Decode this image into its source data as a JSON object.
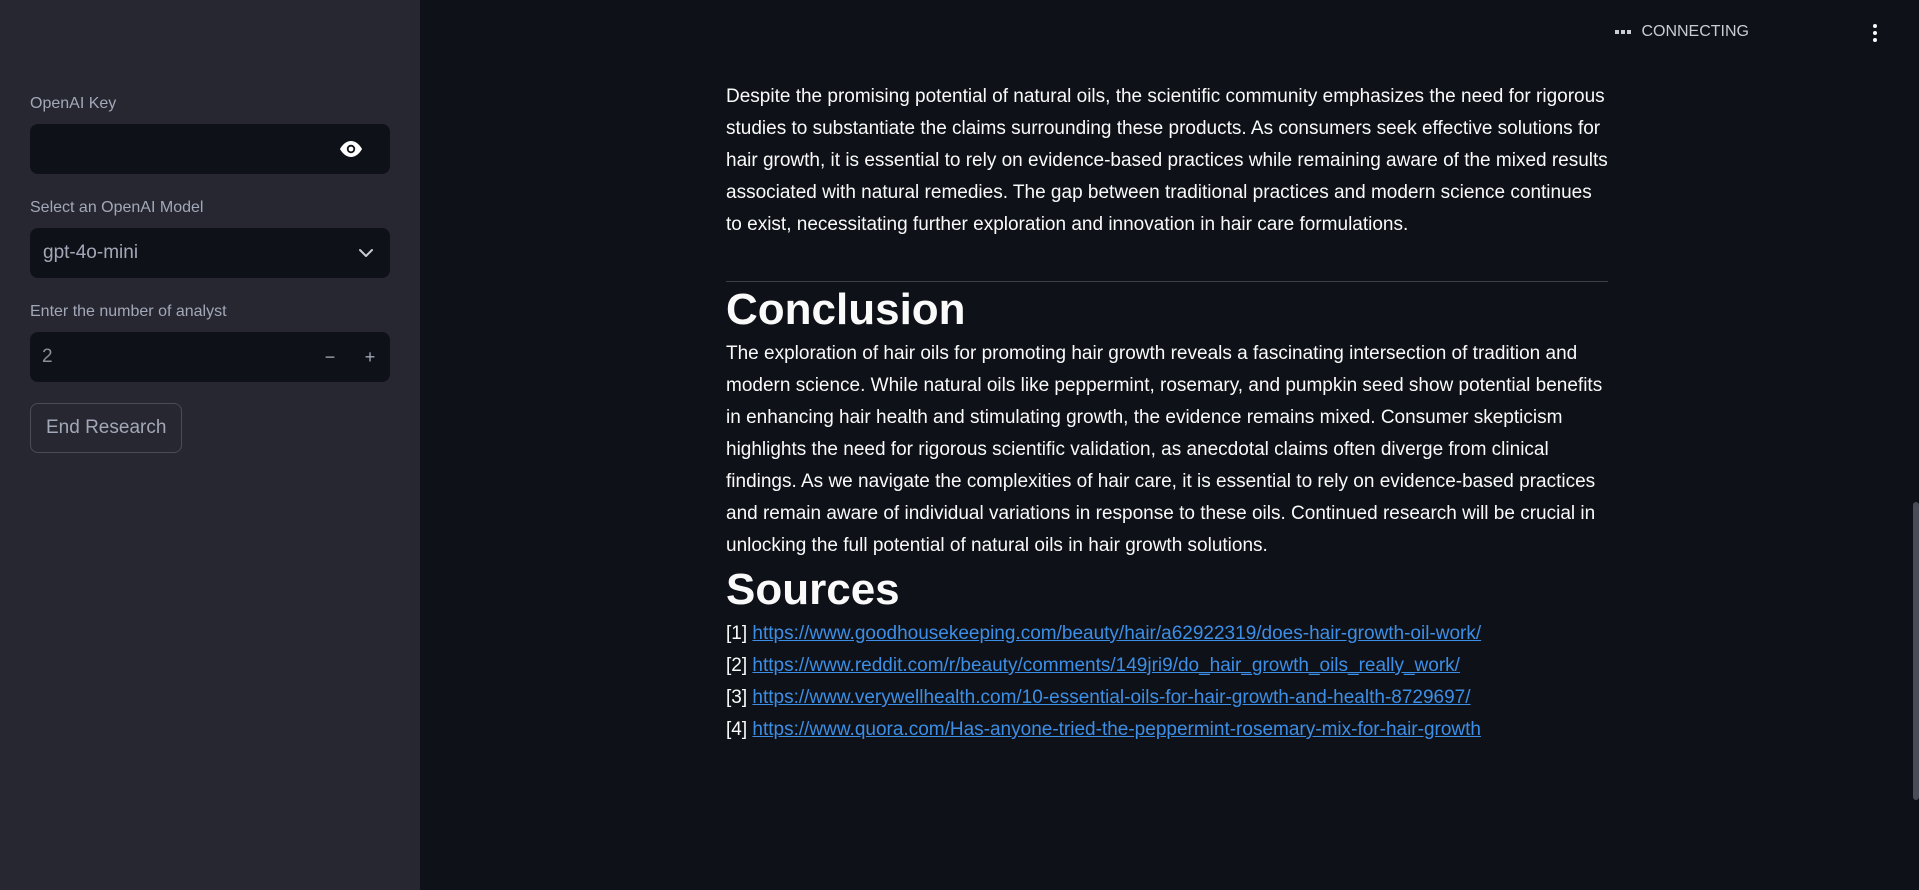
{
  "sidebar": {
    "key_label": "OpenAI Key",
    "key_value": "",
    "model_label": "Select an OpenAI Model",
    "model_value": "gpt-4o-mini",
    "analyst_label": "Enter the number of analyst",
    "analyst_value": "2",
    "decrement_symbol": "−",
    "increment_symbol": "+",
    "end_button": "End Research"
  },
  "header": {
    "status": "CONNECTING"
  },
  "main": {
    "intro_paragraph": "Despite the promising potential of natural oils, the scientific community emphasizes the need for rigorous studies to substantiate the claims surrounding these products. As consumers seek effective solutions for hair growth, it is essential to rely on evidence-based practices while remaining aware of the mixed results associated with natural remedies. The gap between traditional practices and modern science continues to exist, necessitating further exploration and innovation in hair care formulations.",
    "conclusion_title": "Conclusion",
    "conclusion_paragraph": "The exploration of hair oils for promoting hair growth reveals a fascinating intersection of tradition and modern science. While natural oils like peppermint, rosemary, and pumpkin seed show potential benefits in enhancing hair health and stimulating growth, the evidence remains mixed. Consumer skepticism highlights the need for rigorous scientific validation, as anecdotal claims often diverge from clinical findings. As we navigate the complexities of hair care, it is essential to rely on evidence-based practices and remain aware of individual variations in response to these oils. Continued research will be crucial in unlocking the full potential of natural oils in hair growth solutions.",
    "sources_title": "Sources",
    "sources": [
      {
        "num": "[1]",
        "url": "https://www.goodhousekeeping.com/beauty/hair/a62922319/does-hair-growth-oil-work/"
      },
      {
        "num": "[2]",
        "url": "https://www.reddit.com/r/beauty/comments/149jri9/do_hair_growth_oils_really_work/"
      },
      {
        "num": "[3]",
        "url": "https://www.verywellhealth.com/10-essential-oils-for-hair-growth-and-health-8729697/"
      },
      {
        "num": "[4]",
        "url": "https://www.quora.com/Has-anyone-tried-the-peppermint-rosemary-mix-for-hair-growth"
      }
    ]
  },
  "colors": {
    "sidebar_bg": "#262730",
    "main_bg": "#0e1117",
    "link": "#3d8ee6"
  },
  "icons": [
    "eye-icon",
    "chevron-down-icon",
    "connecting-dots-icon",
    "more-vert-icon"
  ]
}
